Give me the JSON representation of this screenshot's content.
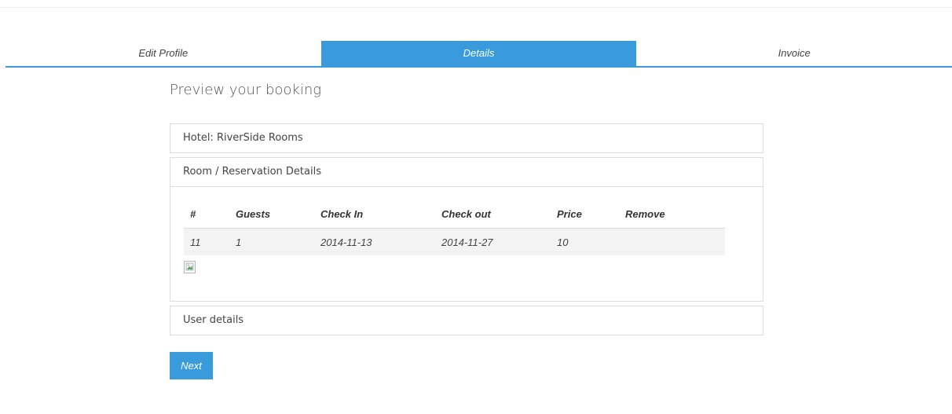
{
  "steps": [
    {
      "label": "Edit Profile",
      "active": false
    },
    {
      "label": "Details",
      "active": true
    },
    {
      "label": "Invoice",
      "active": false
    }
  ],
  "page": {
    "title": "Preview your booking"
  },
  "panels": {
    "hotel": {
      "label": "Hotel: RiverSide Rooms"
    },
    "rooms": {
      "label": "Room / Reservation Details"
    },
    "user": {
      "label": "User details"
    }
  },
  "reservations": {
    "headers": [
      "#",
      "Guests",
      "Check In",
      "Check out",
      "Price",
      "Remove"
    ],
    "rows": [
      [
        "11",
        "1",
        "2014-11-13",
        "2014-11-27",
        "10",
        ""
      ]
    ]
  },
  "actions": {
    "next_label": "Next"
  },
  "colors": {
    "accent": "#3a9bdc"
  }
}
